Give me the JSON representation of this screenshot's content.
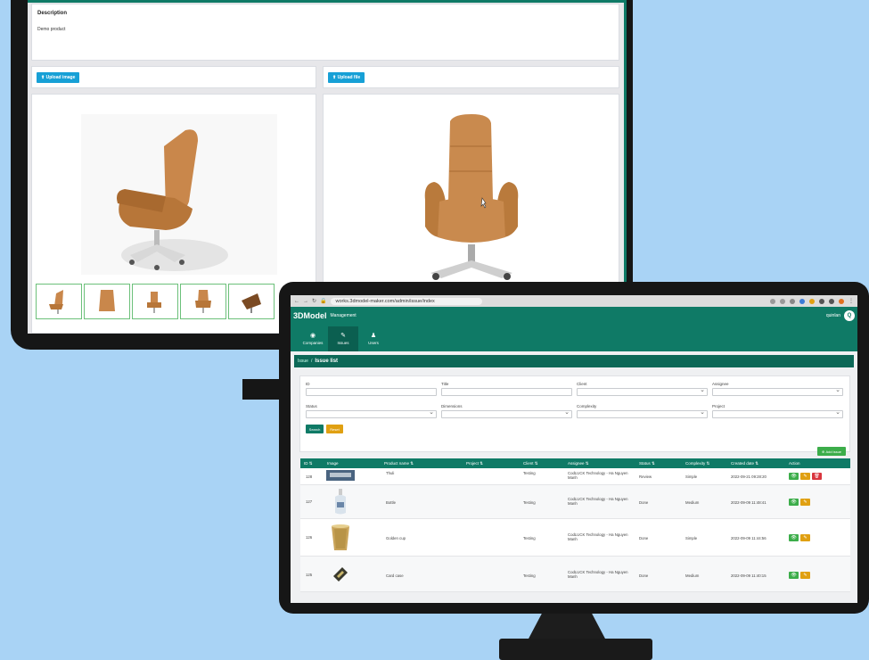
{
  "back_app": {
    "description_title": "Description",
    "description_text": "Demo product",
    "upload_image_label": "Upload image",
    "upload_file_label": "Upload file",
    "accent_color": "#0f7a66",
    "upload_button_color": "#17a0d6"
  },
  "browser": {
    "url": "works.3dmodel-maker.com/admin/issue/index"
  },
  "app": {
    "brand": "3DModel",
    "brand_sub": "Management",
    "user_name": "quinlan",
    "avatar_letter": "Q",
    "nav": [
      {
        "label": "Companies",
        "icon": "companies-icon"
      },
      {
        "label": "Issues",
        "icon": "issues-icon"
      },
      {
        "label": "Users",
        "icon": "users-icon"
      }
    ],
    "breadcrumb_home": "Issue",
    "breadcrumb_current": "Issue list",
    "filters": {
      "id_label": "ID",
      "title_label": "Title",
      "client_label": "Client",
      "assignee_label": "Assignee",
      "status_label": "Status",
      "dimensions_label": "Dimensions",
      "complexity_label": "Complexity",
      "project_label": "Project",
      "search_label": "Search",
      "reset_label": "Reset"
    },
    "add_issue_label": "Add issue",
    "table": {
      "headers": [
        "ID ⇅",
        "Image",
        "Product name ⇅",
        "Project ⇅",
        "Client ⇅",
        "Assignee ⇅",
        "Status ⇅",
        "Complexity ⇅",
        "Created date ⇅",
        "Action"
      ],
      "rows": [
        {
          "id": "128",
          "product": "Thuli",
          "project": "",
          "client": "Testing",
          "assignee": "CodLUCK Technology - Ha Nguyen Manh",
          "status": "Review",
          "complexity": "Simple",
          "created": "2022-09-21 09:28:20"
        },
        {
          "id": "127",
          "product": "Bottle",
          "project": "",
          "client": "Testing",
          "assignee": "CodLUCK Technology - Ha Nguyen Manh",
          "status": "Done",
          "complexity": "Medium",
          "created": "2022-09-09 11:48:41"
        },
        {
          "id": "126",
          "product": "Golden cup",
          "project": "",
          "client": "Testing",
          "assignee": "CodLUCK Technology - Ha Nguyen Manh",
          "status": "Done",
          "complexity": "Simple",
          "created": "2022-09-09 11:44:56"
        },
        {
          "id": "125",
          "product": "Card case",
          "project": "",
          "client": "Testing",
          "assignee": "CodLUCK Technology - Ha Nguyen Manh",
          "status": "Done",
          "complexity": "Medium",
          "created": "2022-09-09 11:40:15"
        }
      ]
    },
    "colors": {
      "primary": "#0f7a66",
      "add": "#3cad4a",
      "edit": "#e0a012",
      "delete": "#d9363e"
    }
  }
}
